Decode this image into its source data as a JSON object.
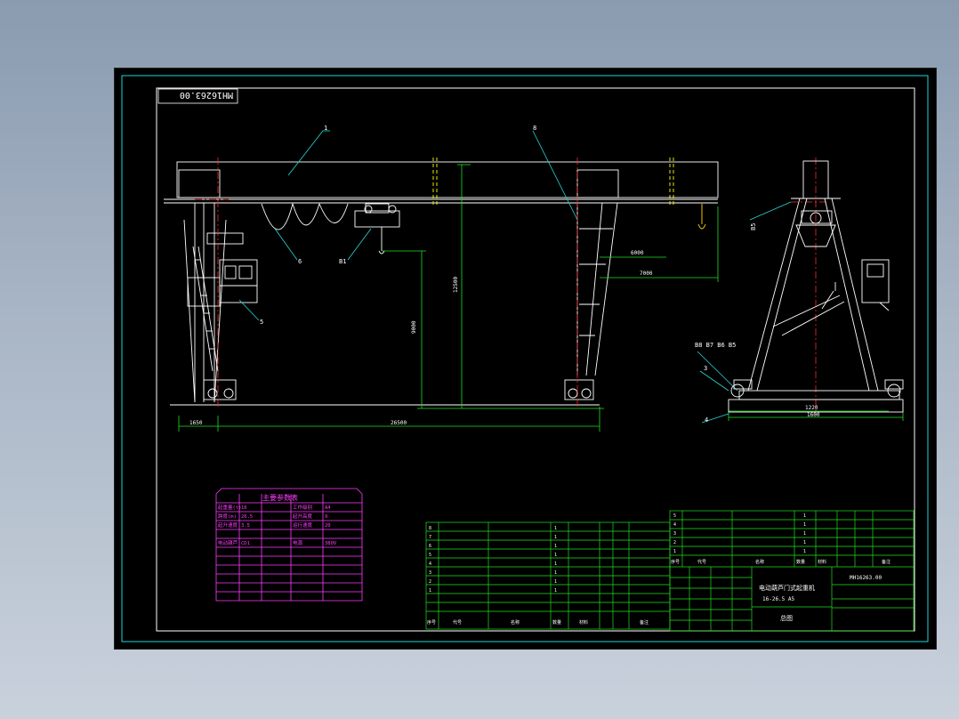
{
  "drawing": {
    "code_stamp": "MH16263.00",
    "balloon_labels": [
      "1",
      "8",
      "6",
      "5",
      "3",
      "4"
    ],
    "balloon_label_smudged_a": "B1",
    "balloon_label_group": "B8 B7 B6 B5",
    "balloon_label_right_top": "B5",
    "dim_left_offset": "1650",
    "dim_span": "26500",
    "dim_hook_travel": "7000",
    "dim_hook_clear": "6000",
    "dim_lift_height": "9000",
    "dim_total_height": "12500",
    "dim_base_width": "1600",
    "dim_rail": "1220"
  },
  "colors": {
    "sheet": "#000000",
    "frame": "#19d7d7",
    "lines": "#ffffff",
    "dims": "#20e020",
    "leaders": "#27d7d7",
    "centerline": "#ff2a2a",
    "magenta": "#ff3dff"
  },
  "tech_table": {
    "title": "主要参数表",
    "rows": [
      [
        "起重量(t)",
        "16",
        "工作级别",
        "A4"
      ],
      [
        "跨度(m)",
        "26.5",
        "起升高度",
        "9"
      ],
      [
        "起升速度",
        "3.5",
        "运行速度",
        "20"
      ],
      [
        "",
        "",
        "",
        ""
      ],
      [
        "电动葫芦",
        "CD1",
        "电源",
        "380V"
      ],
      [
        "",
        "",
        "",
        ""
      ]
    ]
  },
  "bom": {
    "rows": [
      [
        "8",
        "",
        "",
        "1",
        "",
        "",
        ""
      ],
      [
        "7",
        "",
        "",
        "1",
        "",
        "",
        ""
      ],
      [
        "6",
        "",
        "",
        "1",
        "",
        "",
        ""
      ],
      [
        "5",
        "",
        "",
        "1",
        "",
        "",
        ""
      ],
      [
        "4",
        "",
        "",
        "1",
        "",
        "",
        ""
      ],
      [
        "3",
        "",
        "",
        "1",
        "",
        "",
        ""
      ],
      [
        "2",
        "",
        "",
        "1",
        "",
        "",
        ""
      ],
      [
        "1",
        "",
        "",
        "1",
        "",
        "",
        ""
      ],
      [
        "",
        "",
        "",
        "",
        "",
        "",
        ""
      ]
    ],
    "header": [
      "序号",
      "代号",
      "名称",
      "数量",
      "材料",
      "",
      "备注"
    ]
  },
  "right_table": {
    "rows": [
      [
        "5",
        "",
        "",
        "1",
        "",
        "",
        ""
      ],
      [
        "4",
        "",
        "",
        "1",
        "",
        "",
        ""
      ],
      [
        "3",
        "",
        "",
        "1",
        "",
        "",
        ""
      ],
      [
        "2",
        "",
        "",
        "1",
        "",
        "",
        ""
      ],
      [
        "1",
        "",
        "",
        "1",
        "",
        "",
        ""
      ]
    ],
    "header": [
      "序号",
      "代号",
      "名称",
      "数量",
      "材料",
      "",
      "备注"
    ]
  },
  "title_block": {
    "product_name": "电动葫芦门式起重机",
    "spec": "16-26.5 A5",
    "drawing_type": "总图",
    "drawing_no": "MH16263.00"
  }
}
